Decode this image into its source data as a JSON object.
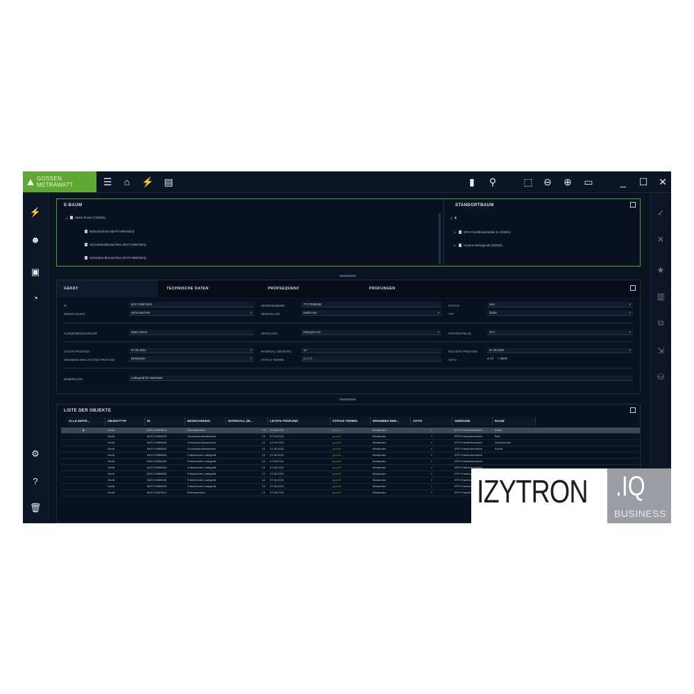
{
  "app": {
    "brand": "GOSSEN METRAWATT",
    "colors": {
      "accent_green": "#5fa833",
      "background": "#0b1220",
      "panel_border": "#4fa233"
    }
  },
  "topbar": {
    "icons": [
      "menu-icon",
      "home-icon",
      "plug-icon",
      "device-icon",
      "door-icon",
      "pin-icon",
      "select-icon",
      "zoom-out-icon",
      "zoom-in-icon",
      "window-icon",
      "minimize-icon",
      "maximize-icon",
      "close-icon"
    ]
  },
  "trees": {
    "e_baum": {
      "title": "E-BAUM",
      "root": "Mario Rossi (C00001)",
      "children": [
        "Bohrmaschine (BATV-098765/4)",
        "Schraubendbmaschine (BATV-098765/4)",
        "Schraubendbmaschine (BATV-098765/4)"
      ]
    },
    "standortbaum": {
      "title": "STANDORTBAUM",
      "children": [
        "EFH Frankfurterstraße 11 (00001)",
        "Gruene Metzgenab (00002)"
      ]
    }
  },
  "detail": {
    "tabs": [
      "GERÄT",
      "TECHNISCHE DATEN",
      "PRÜFSEQUENZ",
      "PRÜFUNGEN"
    ],
    "fields": {
      "id": {
        "label": "ID",
        "value": "BATV-098765/4"
      },
      "bezeichnung": {
        "label": "BEZEICHNUNG",
        "value": "Bohrmaschine"
      },
      "kundenbezeichnung": {
        "label": "KUNDENBEZEICHNUNG",
        "value": "Mario Rossi"
      },
      "letzte_pruefung": {
        "label": "LETZTE PRÜFUNG",
        "value": "07.06.2021"
      },
      "ergebnis": {
        "label": "ERGEBNIS DER LETZTEN PRÜFUNG",
        "value": "Bestanden"
      },
      "bemerkung": {
        "label": "BEMERKUNG",
        "value": "Ladegerät für Werkstatt"
      },
      "seriennummer": {
        "label": "SERIENNUMMER",
        "value": "7TVTR9863B"
      },
      "hersteller": {
        "label": "HERSTELLER",
        "value": "Multicross"
      },
      "abteilung": {
        "label": "ABTEILUNG",
        "value": "Metzgerei 4C"
      },
      "intervall": {
        "label": "INTERVALL (MONATE)",
        "value": "12"
      },
      "status_termin": {
        "label": "STATUS TERMIN",
        "value": "geprüft"
      },
      "status": {
        "label": "STATUS",
        "value": "Neu"
      },
      "typ": {
        "label": "TYP",
        "value": "SLBS"
      },
      "kostenstelle": {
        "label": "KOSTENSTELLE",
        "value": "4CC"
      },
      "naechste_pruefung": {
        "label": "NÄCHSTE PRÜFUNG",
        "value": "07.06.2022"
      },
      "aktiv": {
        "label": "AKTIV",
        "options": [
          "JA",
          "NEIN"
        ]
      }
    }
  },
  "list": {
    "title": "LISTE DER OBJEKTE",
    "columns": [
      "ALLE EINTR...",
      "OBJEKTTYP",
      "ID",
      "BEZEICHNUNG",
      "INTERVALL (M...",
      "LETZTE PRÜFUNG",
      "STATUS TERMIN",
      "ERGEBNIS DER...",
      "AKTIV",
      "GEBÄUDE",
      "RAUM"
    ],
    "rows": [
      {
        "typ": "Gerät",
        "id": "BATV-098765/4",
        "bez": "Bohrmaschine",
        "int": "12",
        "date": "07.06.2021",
        "status": "geprüft",
        "erg": "Bestanden",
        "aktiv": "✓",
        "geb": "EFH Frankfurterstraße",
        "raum": "Keller"
      },
      {
        "typ": "Gerät",
        "id": "BATV-098508/6",
        "bez": "Schraubendbmaschine",
        "int": "12",
        "date": "07.06.2021",
        "status": "geprüft",
        "erg": "Bestanden",
        "aktiv": "✓",
        "geb": "EFH Frankfurterstraße",
        "raum": "Bad"
      },
      {
        "typ": "Gerät",
        "id": "BATV-098508/6",
        "bez": "Schraubendbmaschine",
        "int": "12",
        "date": "07.06.2021",
        "status": "geprüft",
        "erg": "Bestanden",
        "aktiv": "✓",
        "geb": "EFH Frankfurterstraße",
        "raum": "Wohnzimmer"
      },
      {
        "typ": "Gerät",
        "id": "BATV-098508/6",
        "bez": "Schraubendbmaschine",
        "int": "12",
        "date": "07.06.2021",
        "status": "geprüft",
        "erg": "Bestanden",
        "aktiv": "✓",
        "geb": "EFH Frankfurterstraße",
        "raum": "Küche"
      },
      {
        "typ": "Gerät",
        "id": "BATV-098508/6",
        "bez": "Fräsbohrzeit Ladegerät",
        "int": "12",
        "date": "07.06.2021",
        "status": "geprüft",
        "erg": "Bestanden",
        "aktiv": "✓",
        "geb": "EFH Frankfurterstraße",
        "raum": ""
      },
      {
        "typ": "Gerät",
        "id": "BATV-098508/6",
        "bez": "Fräsbohrzeit Ladegerät",
        "int": "12",
        "date": "07.06.2021",
        "status": "geprüft",
        "erg": "Bestanden",
        "aktiv": "✓",
        "geb": "EFH Frankfurterstraße",
        "raum": ""
      },
      {
        "typ": "Gerät",
        "id": "BATV-098508/6",
        "bez": "Fräsbohrzeit Ladegerät",
        "int": "12",
        "date": "07.06.2021",
        "status": "geprüft",
        "erg": "Bestanden",
        "aktiv": "✓",
        "geb": "EFH Frankfurterstraße",
        "raum": ""
      },
      {
        "typ": "Gerät",
        "id": "BATV-098508/6",
        "bez": "Fräsbohrzeit Ladegerät",
        "int": "12",
        "date": "07.06.2021",
        "status": "geprüft",
        "erg": "Bestanden",
        "aktiv": "✓",
        "geb": "EFH Frankfurterstraße",
        "raum": ""
      },
      {
        "typ": "Gerät",
        "id": "BATV-098508/6",
        "bez": "Fräsbohrzeit Ladegerät",
        "int": "12",
        "date": "07.06.2021",
        "status": "geprüft",
        "erg": "Bestanden",
        "aktiv": "✓",
        "geb": "EFH Frankfurterstraße",
        "raum": ""
      },
      {
        "typ": "Gerät",
        "id": "BATV-098508/6",
        "bez": "Fräsbohrzeit Ladegerät",
        "int": "12",
        "date": "07.06.2021",
        "status": "geprüft",
        "erg": "Bestanden",
        "aktiv": "✓",
        "geb": "EFH Frankfurterstraße",
        "raum": ""
      },
      {
        "typ": "Gerät",
        "id": "BATV-098765/4",
        "bez": "Bohrmaschine",
        "int": "12",
        "date": "07.06.2021",
        "status": "geprüft",
        "erg": "Bestanden",
        "aktiv": "✓",
        "geb": "EFH Frankfurterstraße",
        "raum": ""
      }
    ]
  },
  "overlay": {
    "brand": "IZYTRON",
    "suffix": ".IQ",
    "edition": "BUSINESS"
  }
}
